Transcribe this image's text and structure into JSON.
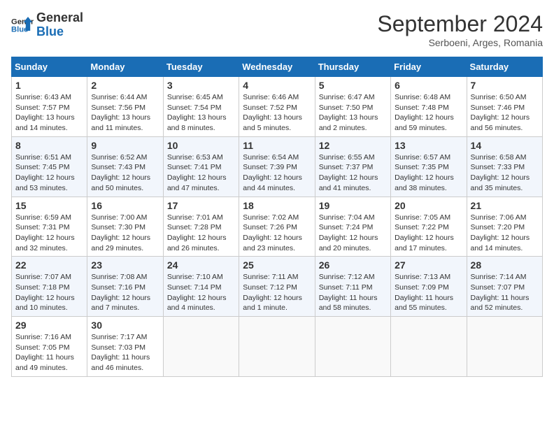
{
  "logo": {
    "line1": "General",
    "line2": "Blue"
  },
  "title": "September 2024",
  "subtitle": "Serboeni, Arges, Romania",
  "days_of_week": [
    "Sunday",
    "Monday",
    "Tuesday",
    "Wednesday",
    "Thursday",
    "Friday",
    "Saturday"
  ],
  "weeks": [
    [
      {
        "num": "1",
        "info": "Sunrise: 6:43 AM\nSunset: 7:57 PM\nDaylight: 13 hours\nand 14 minutes."
      },
      {
        "num": "2",
        "info": "Sunrise: 6:44 AM\nSunset: 7:56 PM\nDaylight: 13 hours\nand 11 minutes."
      },
      {
        "num": "3",
        "info": "Sunrise: 6:45 AM\nSunset: 7:54 PM\nDaylight: 13 hours\nand 8 minutes."
      },
      {
        "num": "4",
        "info": "Sunrise: 6:46 AM\nSunset: 7:52 PM\nDaylight: 13 hours\nand 5 minutes."
      },
      {
        "num": "5",
        "info": "Sunrise: 6:47 AM\nSunset: 7:50 PM\nDaylight: 13 hours\nand 2 minutes."
      },
      {
        "num": "6",
        "info": "Sunrise: 6:48 AM\nSunset: 7:48 PM\nDaylight: 12 hours\nand 59 minutes."
      },
      {
        "num": "7",
        "info": "Sunrise: 6:50 AM\nSunset: 7:46 PM\nDaylight: 12 hours\nand 56 minutes."
      }
    ],
    [
      {
        "num": "8",
        "info": "Sunrise: 6:51 AM\nSunset: 7:45 PM\nDaylight: 12 hours\nand 53 minutes."
      },
      {
        "num": "9",
        "info": "Sunrise: 6:52 AM\nSunset: 7:43 PM\nDaylight: 12 hours\nand 50 minutes."
      },
      {
        "num": "10",
        "info": "Sunrise: 6:53 AM\nSunset: 7:41 PM\nDaylight: 12 hours\nand 47 minutes."
      },
      {
        "num": "11",
        "info": "Sunrise: 6:54 AM\nSunset: 7:39 PM\nDaylight: 12 hours\nand 44 minutes."
      },
      {
        "num": "12",
        "info": "Sunrise: 6:55 AM\nSunset: 7:37 PM\nDaylight: 12 hours\nand 41 minutes."
      },
      {
        "num": "13",
        "info": "Sunrise: 6:57 AM\nSunset: 7:35 PM\nDaylight: 12 hours\nand 38 minutes."
      },
      {
        "num": "14",
        "info": "Sunrise: 6:58 AM\nSunset: 7:33 PM\nDaylight: 12 hours\nand 35 minutes."
      }
    ],
    [
      {
        "num": "15",
        "info": "Sunrise: 6:59 AM\nSunset: 7:31 PM\nDaylight: 12 hours\nand 32 minutes."
      },
      {
        "num": "16",
        "info": "Sunrise: 7:00 AM\nSunset: 7:30 PM\nDaylight: 12 hours\nand 29 minutes."
      },
      {
        "num": "17",
        "info": "Sunrise: 7:01 AM\nSunset: 7:28 PM\nDaylight: 12 hours\nand 26 minutes."
      },
      {
        "num": "18",
        "info": "Sunrise: 7:02 AM\nSunset: 7:26 PM\nDaylight: 12 hours\nand 23 minutes."
      },
      {
        "num": "19",
        "info": "Sunrise: 7:04 AM\nSunset: 7:24 PM\nDaylight: 12 hours\nand 20 minutes."
      },
      {
        "num": "20",
        "info": "Sunrise: 7:05 AM\nSunset: 7:22 PM\nDaylight: 12 hours\nand 17 minutes."
      },
      {
        "num": "21",
        "info": "Sunrise: 7:06 AM\nSunset: 7:20 PM\nDaylight: 12 hours\nand 14 minutes."
      }
    ],
    [
      {
        "num": "22",
        "info": "Sunrise: 7:07 AM\nSunset: 7:18 PM\nDaylight: 12 hours\nand 10 minutes."
      },
      {
        "num": "23",
        "info": "Sunrise: 7:08 AM\nSunset: 7:16 PM\nDaylight: 12 hours\nand 7 minutes."
      },
      {
        "num": "24",
        "info": "Sunrise: 7:10 AM\nSunset: 7:14 PM\nDaylight: 12 hours\nand 4 minutes."
      },
      {
        "num": "25",
        "info": "Sunrise: 7:11 AM\nSunset: 7:12 PM\nDaylight: 12 hours\nand 1 minute."
      },
      {
        "num": "26",
        "info": "Sunrise: 7:12 AM\nSunset: 7:11 PM\nDaylight: 11 hours\nand 58 minutes."
      },
      {
        "num": "27",
        "info": "Sunrise: 7:13 AM\nSunset: 7:09 PM\nDaylight: 11 hours\nand 55 minutes."
      },
      {
        "num": "28",
        "info": "Sunrise: 7:14 AM\nSunset: 7:07 PM\nDaylight: 11 hours\nand 52 minutes."
      }
    ],
    [
      {
        "num": "29",
        "info": "Sunrise: 7:16 AM\nSunset: 7:05 PM\nDaylight: 11 hours\nand 49 minutes."
      },
      {
        "num": "30",
        "info": "Sunrise: 7:17 AM\nSunset: 7:03 PM\nDaylight: 11 hours\nand 46 minutes."
      },
      {
        "num": "",
        "info": ""
      },
      {
        "num": "",
        "info": ""
      },
      {
        "num": "",
        "info": ""
      },
      {
        "num": "",
        "info": ""
      },
      {
        "num": "",
        "info": ""
      }
    ]
  ]
}
